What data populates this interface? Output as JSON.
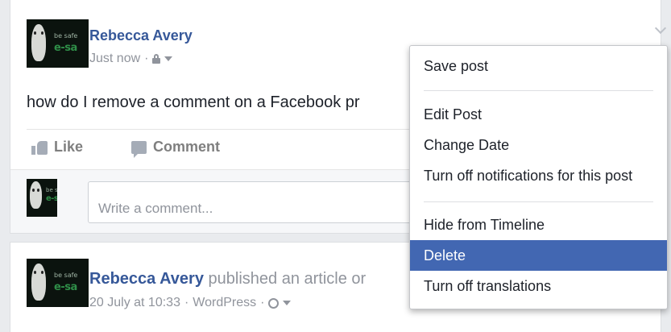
{
  "post": {
    "author": "Rebecca Avery",
    "time": "Just now",
    "text": "how do I remove a comment on a Facebook pr",
    "avatar_tag": "be safe",
    "avatar_tag2": "e-sa",
    "actions": {
      "like": "Like",
      "comment": "Comment"
    },
    "comment_placeholder": "Write a comment..."
  },
  "menu": {
    "items": [
      {
        "label": "Save post"
      },
      {
        "label": "Edit Post"
      },
      {
        "label": "Change Date"
      },
      {
        "label": "Turn off notifications for this post"
      },
      {
        "label": "Hide from Timeline"
      },
      {
        "label": "Delete",
        "active": true
      },
      {
        "label": "Turn off translations"
      }
    ]
  },
  "post2": {
    "author": "Rebecca Avery",
    "action": "published an article or",
    "time": "20 July at 10:33",
    "source": "WordPress"
  },
  "colors": {
    "link_blue": "#365899",
    "menu_highlight": "#4267b2",
    "meta_gray": "#90949c"
  }
}
